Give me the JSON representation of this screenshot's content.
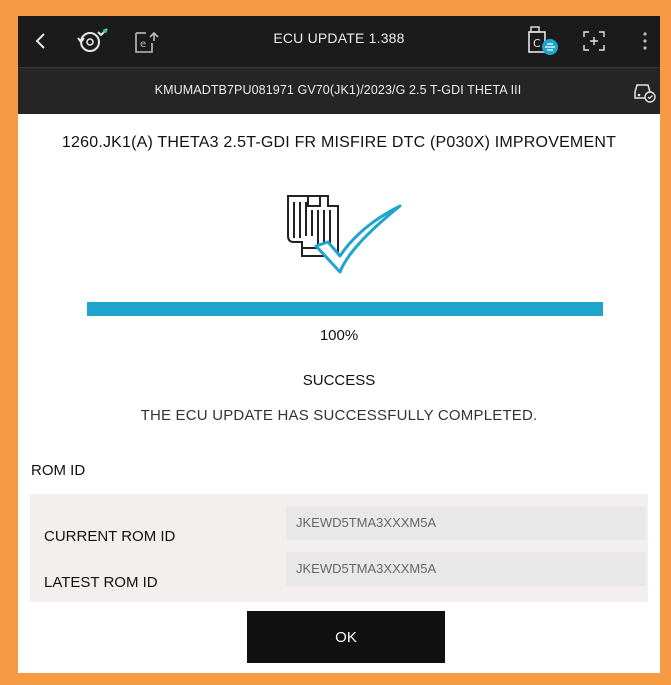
{
  "header": {
    "title": "ECU UPDATE 1.388",
    "back_icon": "chevron-left-icon",
    "vehicle_info": "KMUMADTB7PU081971  GV70(JK1)/2023/G 2.5 T-GDI THETA III"
  },
  "main": {
    "heading": "1260.JK1(A) THETA3 2.5T-GDI FR MISFIRE DTC (P030X) IMPROVEMENT",
    "progress_percent": 100,
    "progress_text": "100%",
    "status": "SUCCESS",
    "message": "THE ECU UPDATE HAS SUCCESSFULLY COMPLETED."
  },
  "rom": {
    "section_title": "ROM ID",
    "rows": [
      {
        "label": "CURRENT ROM ID",
        "value": "JKEWD5TMA3XXXM5A"
      },
      {
        "label": "LATEST ROM ID",
        "value": "JKEWD5TMA3XXXM5A"
      }
    ]
  },
  "actions": {
    "ok_label": "OK"
  },
  "colors": {
    "frame": "#f79a44",
    "header_bg": "#1b1b1b",
    "progress": "#1fa5cc",
    "button_bg": "#111111"
  }
}
